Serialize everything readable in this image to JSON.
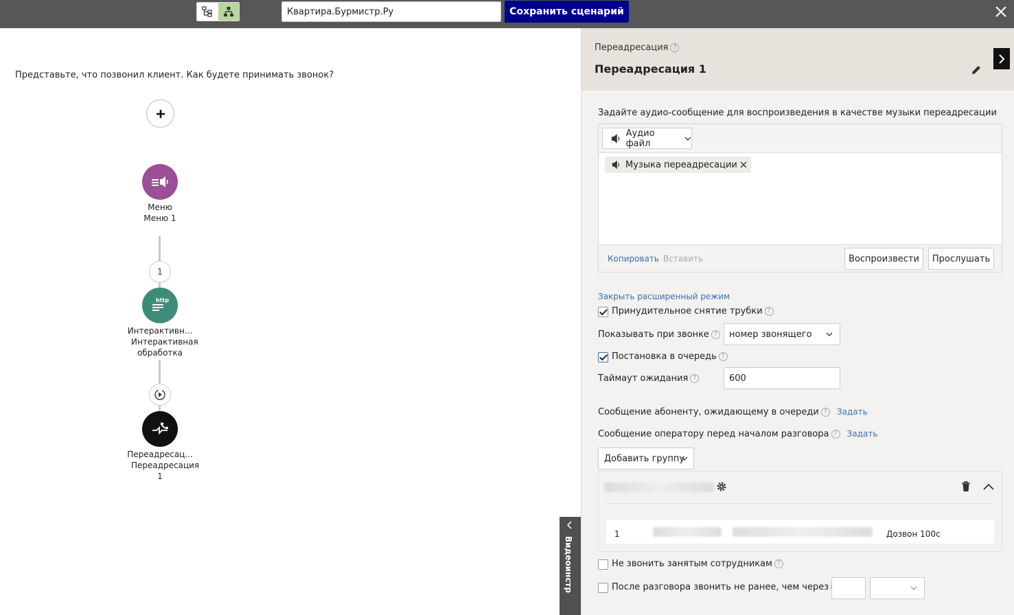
{
  "topbar": {
    "scenario_name": "Квартира.Бурмистр.Ру",
    "save_label": "Сохранить сценарий",
    "accent": "#00008b"
  },
  "canvas": {
    "prompt": "Представьте, что позвонил клиент. Как будете принимать звонок?",
    "nodes": [
      {
        "type": "Меню",
        "name": "Меню 1",
        "color": "#9b4f96",
        "icon": "menu-speaker-icon"
      },
      {
        "type": "Интерактивн...",
        "name": "Интерактивная обработка",
        "color": "#3d8c7a",
        "icon": "http-icon"
      },
      {
        "type": "Переадресац...",
        "name": "Переадресация 1",
        "color": "#111111",
        "icon": "redirect-phone-icon"
      }
    ],
    "step_label_1": "1",
    "video_tab": "Видеоинстр"
  },
  "panel": {
    "type_label": "Переадресация",
    "title": "Переадресация 1",
    "audio_label": "Задайте аудио-сообщение для воспроизведения в качестве музыки переадресации",
    "audio_type": "Аудио файл",
    "audio_chip": "Музыка переадресации",
    "copy": "Копировать",
    "paste": "Вставить",
    "play": "Воспроизвести",
    "listen": "Прослушать",
    "close_advanced": "Закрыть расширенный режим",
    "force_pickup": "Принудительное снятие трубки",
    "show_on_call": "Показывать при звонке",
    "show_on_call_value": "номер звонящего",
    "queue": "Постановка в очередь",
    "wait_timeout": "Таймаут ожидания",
    "wait_timeout_value": "600",
    "queue_msg": "Сообщение абоненту, ожидающему в очереди",
    "operator_msg": "Сообщение оператору перед началом разговора",
    "set": "Задать",
    "add_group": "Добавить группу",
    "group_row": {
      "index": "1",
      "dial": "Дозвон 100с"
    },
    "no_busy": "Не звонить занятым сотрудникам",
    "after_call": "После разговора звонить не ранее, чем через"
  }
}
